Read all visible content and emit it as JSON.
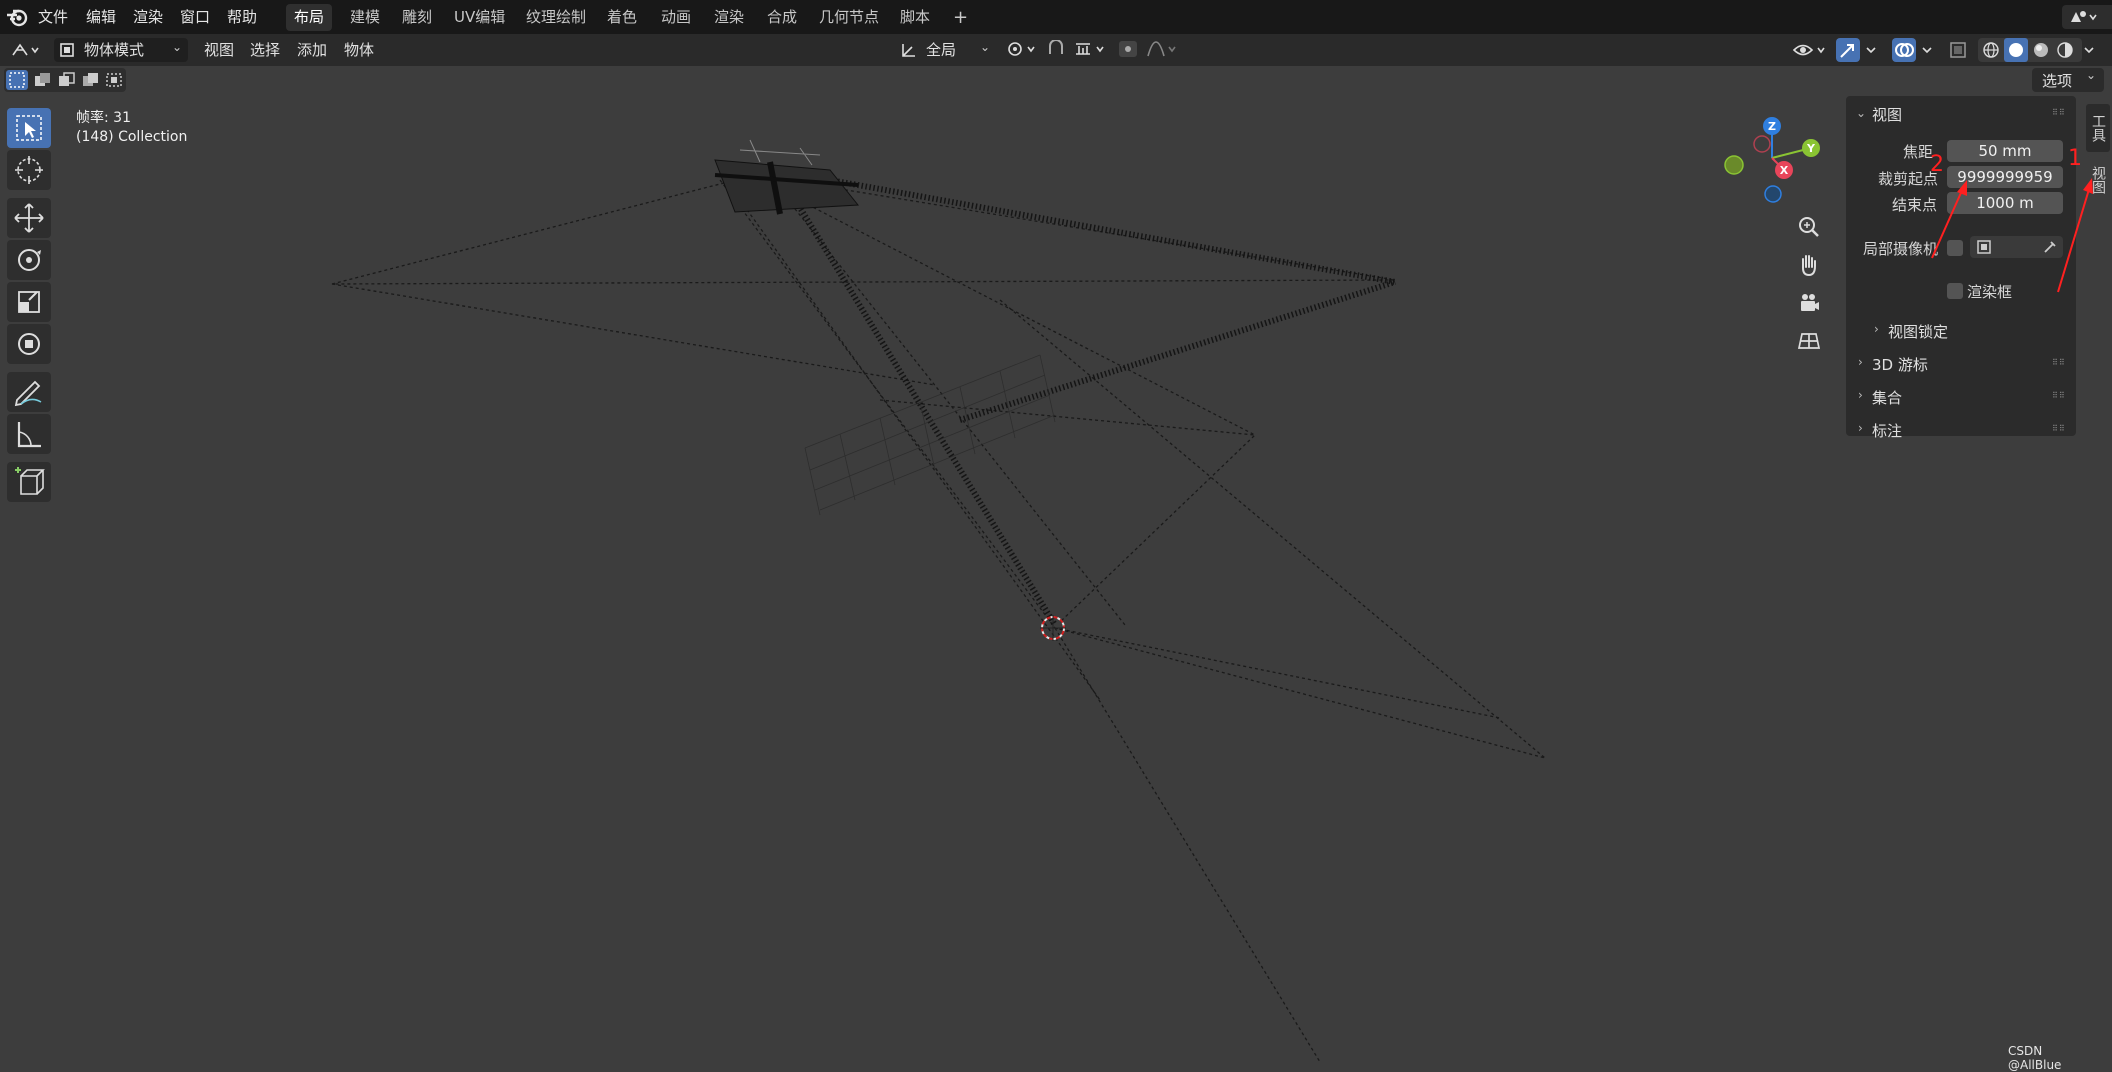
{
  "menu": {
    "items": [
      "文件",
      "编辑",
      "渲染",
      "窗口",
      "帮助"
    ]
  },
  "workspaces": {
    "tabs": [
      "布局",
      "建模",
      "雕刻",
      "UV编辑",
      "纹理绘制",
      "着色",
      "动画",
      "渲染",
      "合成",
      "几何节点",
      "脚本"
    ],
    "active": "布局",
    "add_label": "+"
  },
  "header": {
    "mode": "物体模式",
    "menus": [
      "视图",
      "选择",
      "添加",
      "物体"
    ],
    "transform_orientation": "全局",
    "options_label": "选项"
  },
  "viewport": {
    "fps_label": "帧率: 31",
    "collection_label": "(148) Collection",
    "gizmo": {
      "x": "X",
      "y": "Y",
      "z": "Z"
    },
    "watermark": "CSDN @AllBlue"
  },
  "colors": {
    "x_axis": "#e8455a",
    "y_axis": "#8ac433",
    "z_axis": "#2f7fe0",
    "active_tool": "#4772b3",
    "annotation": "#ff2020"
  },
  "npanel": {
    "view_section": "视图",
    "focal_label": "焦距",
    "focal_value": "50 mm",
    "clip_start_label": "裁剪起点",
    "clip_start_value": "9999999959",
    "clip_end_label": "结束点",
    "clip_end_value": "1000 m",
    "local_camera_label": "局部摄像机",
    "render_region_label": "渲染框",
    "view_lock_label": "视图锁定",
    "cursor_section": "3D 游标",
    "collections_section": "集合",
    "annotations_section": "标注"
  },
  "side_tabs": [
    "工具",
    "视图"
  ],
  "annotations": [
    "1",
    "2"
  ]
}
